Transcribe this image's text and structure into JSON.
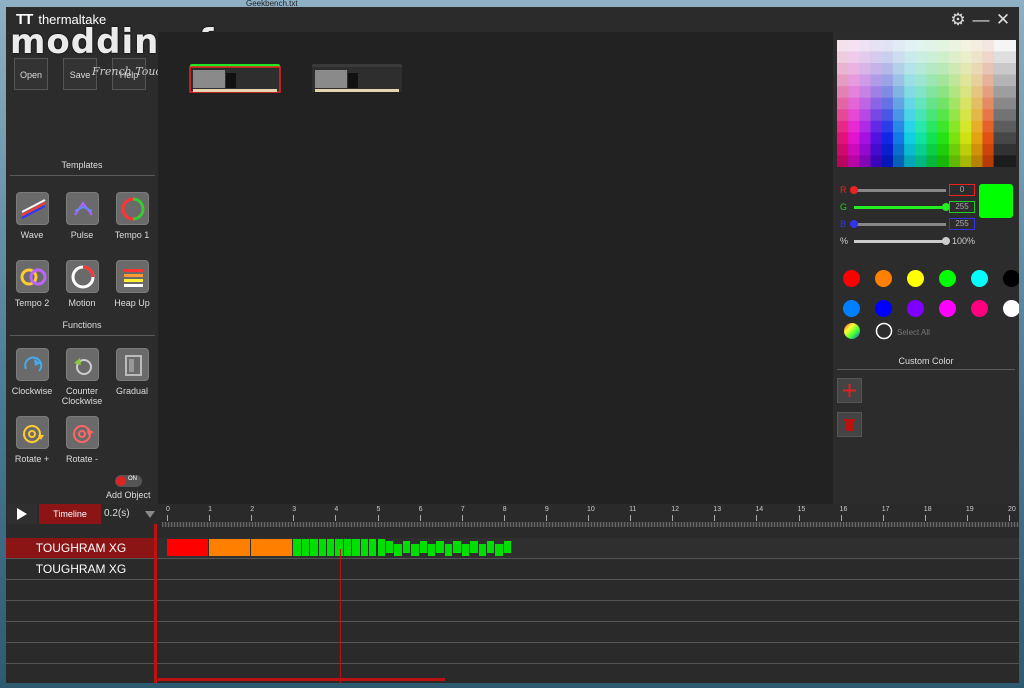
{
  "desktop": {
    "window_caption": "Geekbench.txt"
  },
  "app": {
    "brand_mark": "TT",
    "brand_name": "thermaltake",
    "watermark": "modding.fr",
    "watermark_sub": "French Touch",
    "settings_icon": "gear-icon",
    "minimize_icon": "minimize-icon",
    "close_icon": "close-icon"
  },
  "file": {
    "open": "Open",
    "save": "Save",
    "help": "Help"
  },
  "templates": {
    "header": "Templates",
    "items": [
      {
        "label": "Wave",
        "icon": "wave-icon"
      },
      {
        "label": "Pulse",
        "icon": "pulse-icon"
      },
      {
        "label": "Tempo 1",
        "icon": "tempo1-icon"
      },
      {
        "label": "Tempo 2",
        "icon": "tempo2-icon"
      },
      {
        "label": "Motion",
        "icon": "motion-icon"
      },
      {
        "label": "Heap Up",
        "icon": "heap-up-icon"
      }
    ]
  },
  "functions": {
    "header": "Functions",
    "items": [
      {
        "label": "Clockwise",
        "icon": "clockwise-icon"
      },
      {
        "label": "Counter Clockwise",
        "icon": "counter-clockwise-icon"
      },
      {
        "label": "Gradual",
        "icon": "gradual-icon"
      },
      {
        "label": "Rotate +",
        "icon": "rotate-plus-icon"
      },
      {
        "label": "Rotate -",
        "icon": "rotate-minus-icon"
      }
    ]
  },
  "add_object": {
    "label": "Add Object",
    "toggle": "ON"
  },
  "color": {
    "r_label": "R",
    "g_label": "G",
    "b_label": "B",
    "pct_label": "%",
    "r": "0",
    "g": "255",
    "b": "255",
    "r_fraction": 0.0,
    "g_fraction": 1.0,
    "b_fraction": 0.0,
    "brightness": "100%",
    "brightness_fraction": 1.0,
    "preview": "#00ff00",
    "swatches": [
      "#ff0000",
      "#ff8000",
      "#ffff00",
      "#00ff00",
      "#00ffff",
      "#000000",
      "#0080ff",
      "#0000ff",
      "#8000ff",
      "#ff00ff",
      "#ff0080",
      "#ffffff"
    ],
    "select_all": "Select All",
    "custom_header": "Custom Color",
    "add_icon": "plus-icon",
    "delete_icon": "trash-icon"
  },
  "timeline": {
    "label": "Timeline",
    "interval": "0.2(s)",
    "play_icon": "play-icon",
    "ticks": [
      "0",
      "1",
      "2",
      "3",
      "4",
      "5",
      "6",
      "7",
      "8",
      "9",
      "10",
      "11",
      "12",
      "13",
      "14",
      "15",
      "16",
      "17",
      "18",
      "19",
      "20"
    ],
    "tracks": [
      {
        "name": "TOUGHRAM XG",
        "selected": true
      },
      {
        "name": "TOUGHRAM XG",
        "selected": false
      }
    ]
  }
}
